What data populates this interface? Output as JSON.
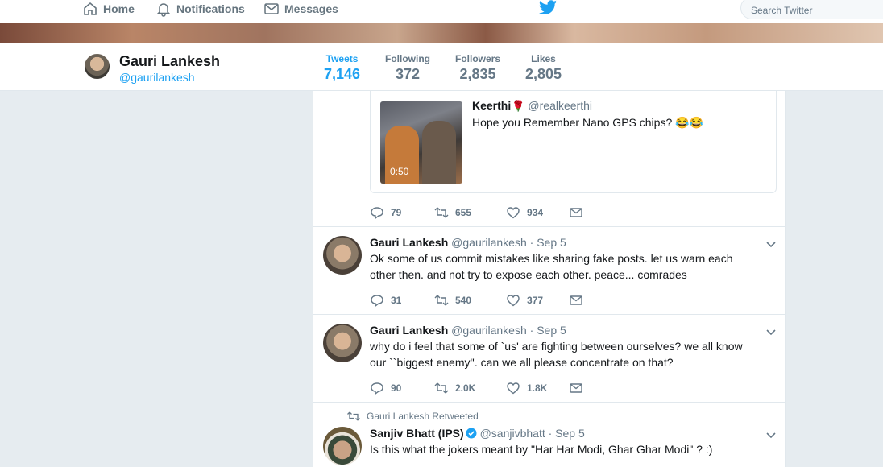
{
  "nav": {
    "home": "Home",
    "notifications": "Notifications",
    "messages": "Messages",
    "search_placeholder": "Search Twitter"
  },
  "profile": {
    "name": "Gauri Lankesh",
    "handle": "@gaurilankesh",
    "stats": [
      {
        "label": "Tweets",
        "value": "7,146"
      },
      {
        "label": "Following",
        "value": "372"
      },
      {
        "label": "Followers",
        "value": "2,835"
      },
      {
        "label": "Likes",
        "value": "2,805"
      }
    ]
  },
  "quoted": {
    "name": "Keerthi",
    "rose": "🌹",
    "handle": "@realkeerthi",
    "text": "Hope you Remember Nano GPS chips? 😂😂",
    "video_time": "0:50",
    "replies": "79",
    "retweets": "655",
    "likes": "934"
  },
  "tweets": [
    {
      "name": "Gauri Lankesh",
      "meta": "@gaurilankesh · Sep 5",
      "text": "Ok some of us commit mistakes like sharing fake posts. let us warn each other then. and not try to expose each other. peace... comrades",
      "replies": "31",
      "retweets": "540",
      "likes": "377"
    },
    {
      "name": "Gauri Lankesh",
      "meta": "@gaurilankesh · Sep 5",
      "text": "why do i feel that some of `us' are fighting between ourselves? we all know our ``biggest enemy''. can we all please concentrate on that?",
      "replies": "90",
      "retweets": "2.0K",
      "likes": "1.8K"
    },
    {
      "retweet_label": "Gauri Lankesh Retweeted",
      "name": "Sanjiv Bhatt (IPS)",
      "meta": "@sanjivbhatt · Sep 5",
      "text": "Is this what the jokers meant by \"Har Har Modi, Ghar Ghar Modi\" ? :)"
    }
  ],
  "colors": {
    "accent": "#1da1f2",
    "muted": "#657786",
    "border": "#e1e8ed",
    "background": "#e6ecf0"
  }
}
